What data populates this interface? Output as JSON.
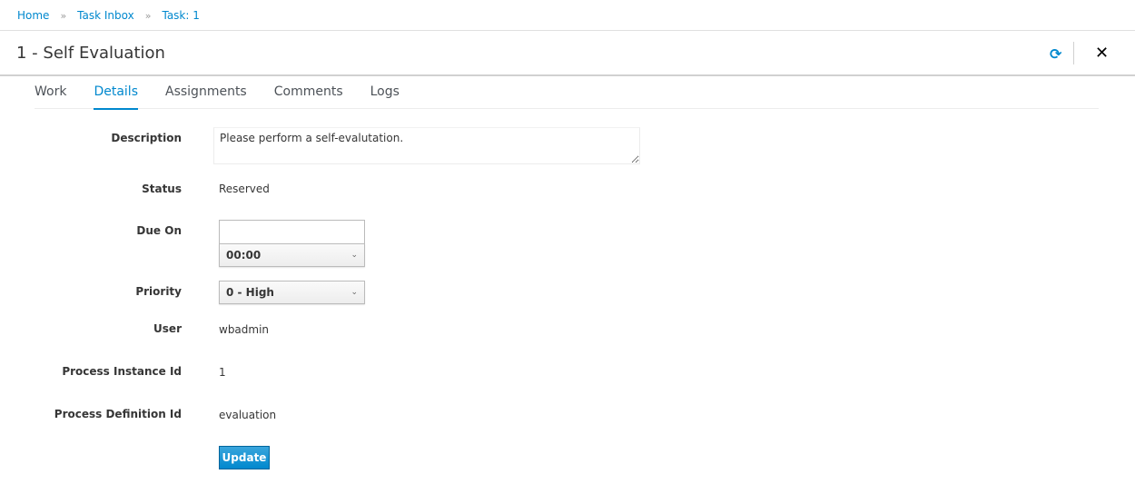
{
  "breadcrumb": {
    "items": [
      "Home",
      "Task Inbox",
      "Task: 1"
    ],
    "separator": "»"
  },
  "header": {
    "title": "1 - Self Evaluation",
    "refresh_icon": "refresh-icon",
    "close_icon": "close-icon",
    "close_glyph": "✕",
    "refresh_glyph": "⟳"
  },
  "tabs": [
    {
      "label": "Work"
    },
    {
      "label": "Details",
      "active": true
    },
    {
      "label": "Assignments"
    },
    {
      "label": "Comments"
    },
    {
      "label": "Logs"
    }
  ],
  "form": {
    "description_label": "Description",
    "description_value": "Please perform a self-evalutation.",
    "status_label": "Status",
    "status_value": "Reserved",
    "due_on_label": "Due On",
    "due_on_value": "",
    "due_time": "00:00",
    "priority_label": "Priority",
    "priority_value": "0 - High",
    "user_label": "User",
    "user_value": "wbadmin",
    "process_instance_label": "Process Instance Id",
    "process_instance_value": "1",
    "process_definition_label": "Process Definition Id",
    "process_definition_value": "evaluation",
    "update_label": "Update"
  },
  "colors": {
    "accent": "#0088ce"
  }
}
